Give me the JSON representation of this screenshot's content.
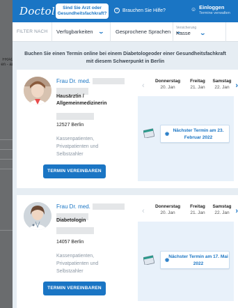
{
  "background": {
    "fragment_line1": "FRAG",
    "fragment_line2": "en - au"
  },
  "header": {
    "logo": "Doctolib",
    "arzt_button": "Sind Sie Arzt oder Gesundheitsfachkraft?",
    "help": "Brauchen Sie Hilfe?",
    "login_title": "Einloggen",
    "login_sub": "Termine verwalten"
  },
  "filters": {
    "label": "FILTER NACH",
    "availability": "Verfügbarkeiten",
    "languages": "Gesprochene Sprachen",
    "insurance_small": "Versicherung",
    "insurance_value": "Kasse"
  },
  "intro": "Buchen Sie einen Termin online bei einem Diabetologeoder einer Gesundheitsfachkraft mit diesem Schwerpunkt in Berlin",
  "doctors": [
    {
      "name_prefix": "Frau Dr. med.",
      "specialty": "Hausärztin / Allgemeinmedizinerin",
      "city": "12527 Berlin",
      "insurance": "Kassenpatienten, Privatpatienten und Selbstzahler",
      "book_label": "TERMIN VEREINBAREN",
      "days": [
        {
          "name": "Donnerstag",
          "date": "20. Jan"
        },
        {
          "name": "Freitag",
          "date": "21. Jan"
        },
        {
          "name": "Samstag",
          "date": "22. Jan"
        }
      ],
      "next_appointment": "Nächster Termin am 23. Februar 2022"
    },
    {
      "name_prefix": "Frau Dr. med.",
      "specialty": "Diabetologin",
      "city": "14057 Berlin",
      "insurance": "Kassenpatienten, Privatpatienten und Selbstzahler",
      "book_label": "TERMIN VEREINBAREN",
      "days": [
        {
          "name": "Donnerstag",
          "date": "20. Jan"
        },
        {
          "name": "Freitag",
          "date": "21. Jan"
        },
        {
          "name": "Samstag",
          "date": "22. Jan"
        }
      ],
      "next_appointment": "Nächster Termin am 17. Mai 2022"
    }
  ],
  "colors": {
    "brand": "#1a75c4",
    "slot_bg": "#e8f1fa",
    "panel_bg": "#e6edf3"
  }
}
